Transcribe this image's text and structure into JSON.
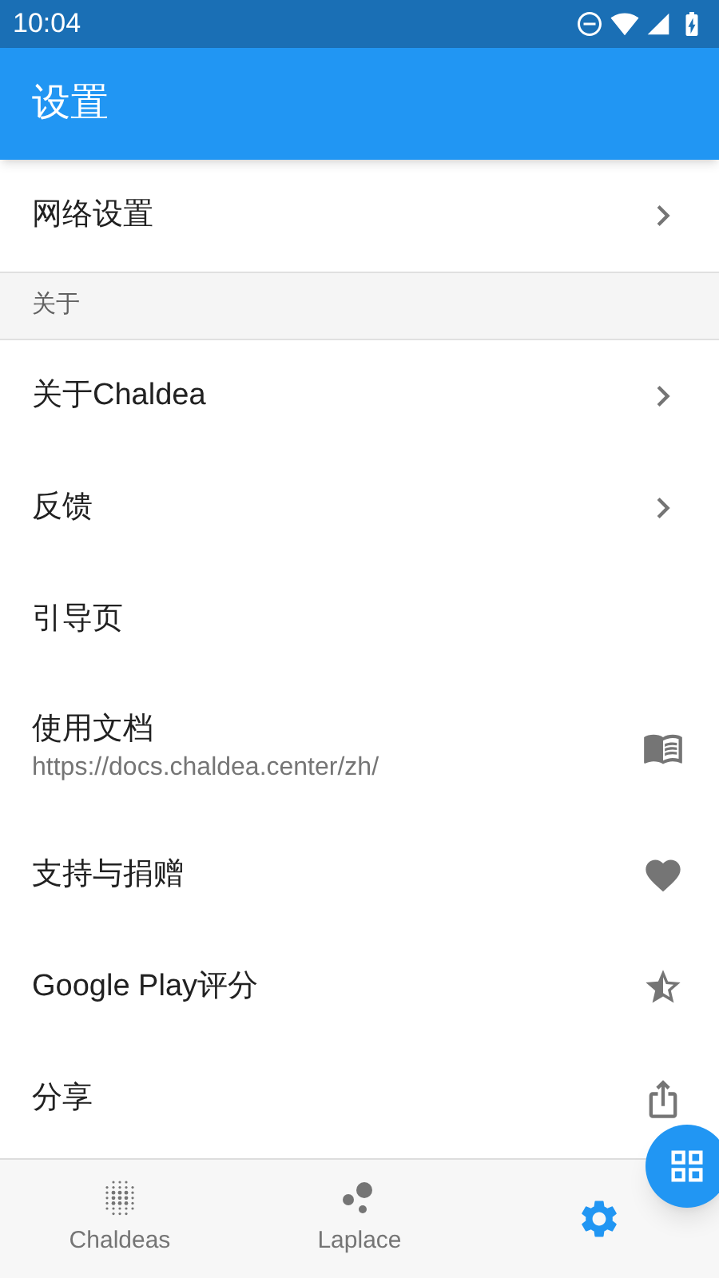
{
  "status_bar": {
    "time": "10:04"
  },
  "app_bar": {
    "title": "设置"
  },
  "sections": [
    {
      "items": [
        {
          "kind": "navigate",
          "title": "网络设置"
        }
      ]
    },
    {
      "header": "关于",
      "items": [
        {
          "kind": "navigate",
          "title": "关于Chaldea"
        },
        {
          "kind": "navigate",
          "title": "反馈"
        },
        {
          "kind": "plain",
          "title": "引导页"
        },
        {
          "kind": "docs",
          "title": "使用文档",
          "subtitle": "https://docs.chaldea.center/zh/"
        },
        {
          "kind": "donate",
          "title": "支持与捐赠"
        },
        {
          "kind": "rate",
          "title": "Google Play评分"
        },
        {
          "kind": "share",
          "title": "分享"
        }
      ]
    }
  ],
  "bottom_nav": [
    {
      "kind": "chaldeas",
      "label": "Chaldeas",
      "selected": false
    },
    {
      "kind": "laplace",
      "label": "Laplace",
      "selected": false
    },
    {
      "kind": "settings",
      "selected": true
    }
  ]
}
